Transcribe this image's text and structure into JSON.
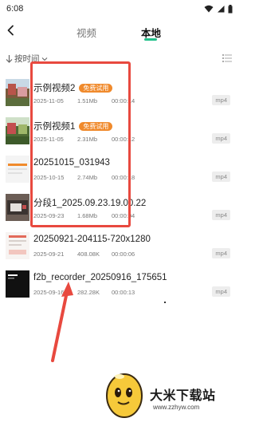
{
  "status_bar": {
    "time": "6:08"
  },
  "header": {
    "tabs": [
      {
        "label": "视频",
        "active": false
      },
      {
        "label": "本地",
        "active": true
      }
    ],
    "accent_color": "#22c08a"
  },
  "sort": {
    "label": "按时间"
  },
  "files": [
    {
      "name": "示例视频2",
      "badge": "免费试用",
      "date": "2025-11-05",
      "size": "1.51Mb",
      "duration": "00:00:14",
      "format": "mp4",
      "thumb": "pink-village"
    },
    {
      "name": "示例视频1",
      "badge": "免费试用",
      "date": "2025-11-05",
      "size": "2.31Mb",
      "duration": "00:00:12",
      "format": "mp4",
      "thumb": "green-village"
    },
    {
      "name": "20251015_031943",
      "badge": "",
      "date": "2025-10-15",
      "size": "2.74Mb",
      "duration": "00:00:18",
      "format": "mp4",
      "thumb": "white-doc"
    },
    {
      "name": "分段1_2025.09.23.19.00.22",
      "badge": "",
      "date": "2025-09-23",
      "size": "1.68Mb",
      "duration": "00:00:04",
      "format": "mp4",
      "thumb": "dark-screen"
    },
    {
      "name": "20250921-204115-720x1280",
      "badge": "",
      "date": "2025-09-21",
      "size": "408.08K",
      "duration": "00:00:06",
      "format": "mp4",
      "thumb": "light-screen"
    },
    {
      "name": "f2b_recorder_20250916_175651",
      "badge": "",
      "date": "2025-09-16",
      "size": "282.28K",
      "duration": "00:00:13",
      "format": "mp4",
      "thumb": "black-screen"
    }
  ],
  "annotation": {
    "color": "#e8493f"
  },
  "watermark": {
    "text": "大米下载站",
    "url": "www.zzhyw.com"
  }
}
